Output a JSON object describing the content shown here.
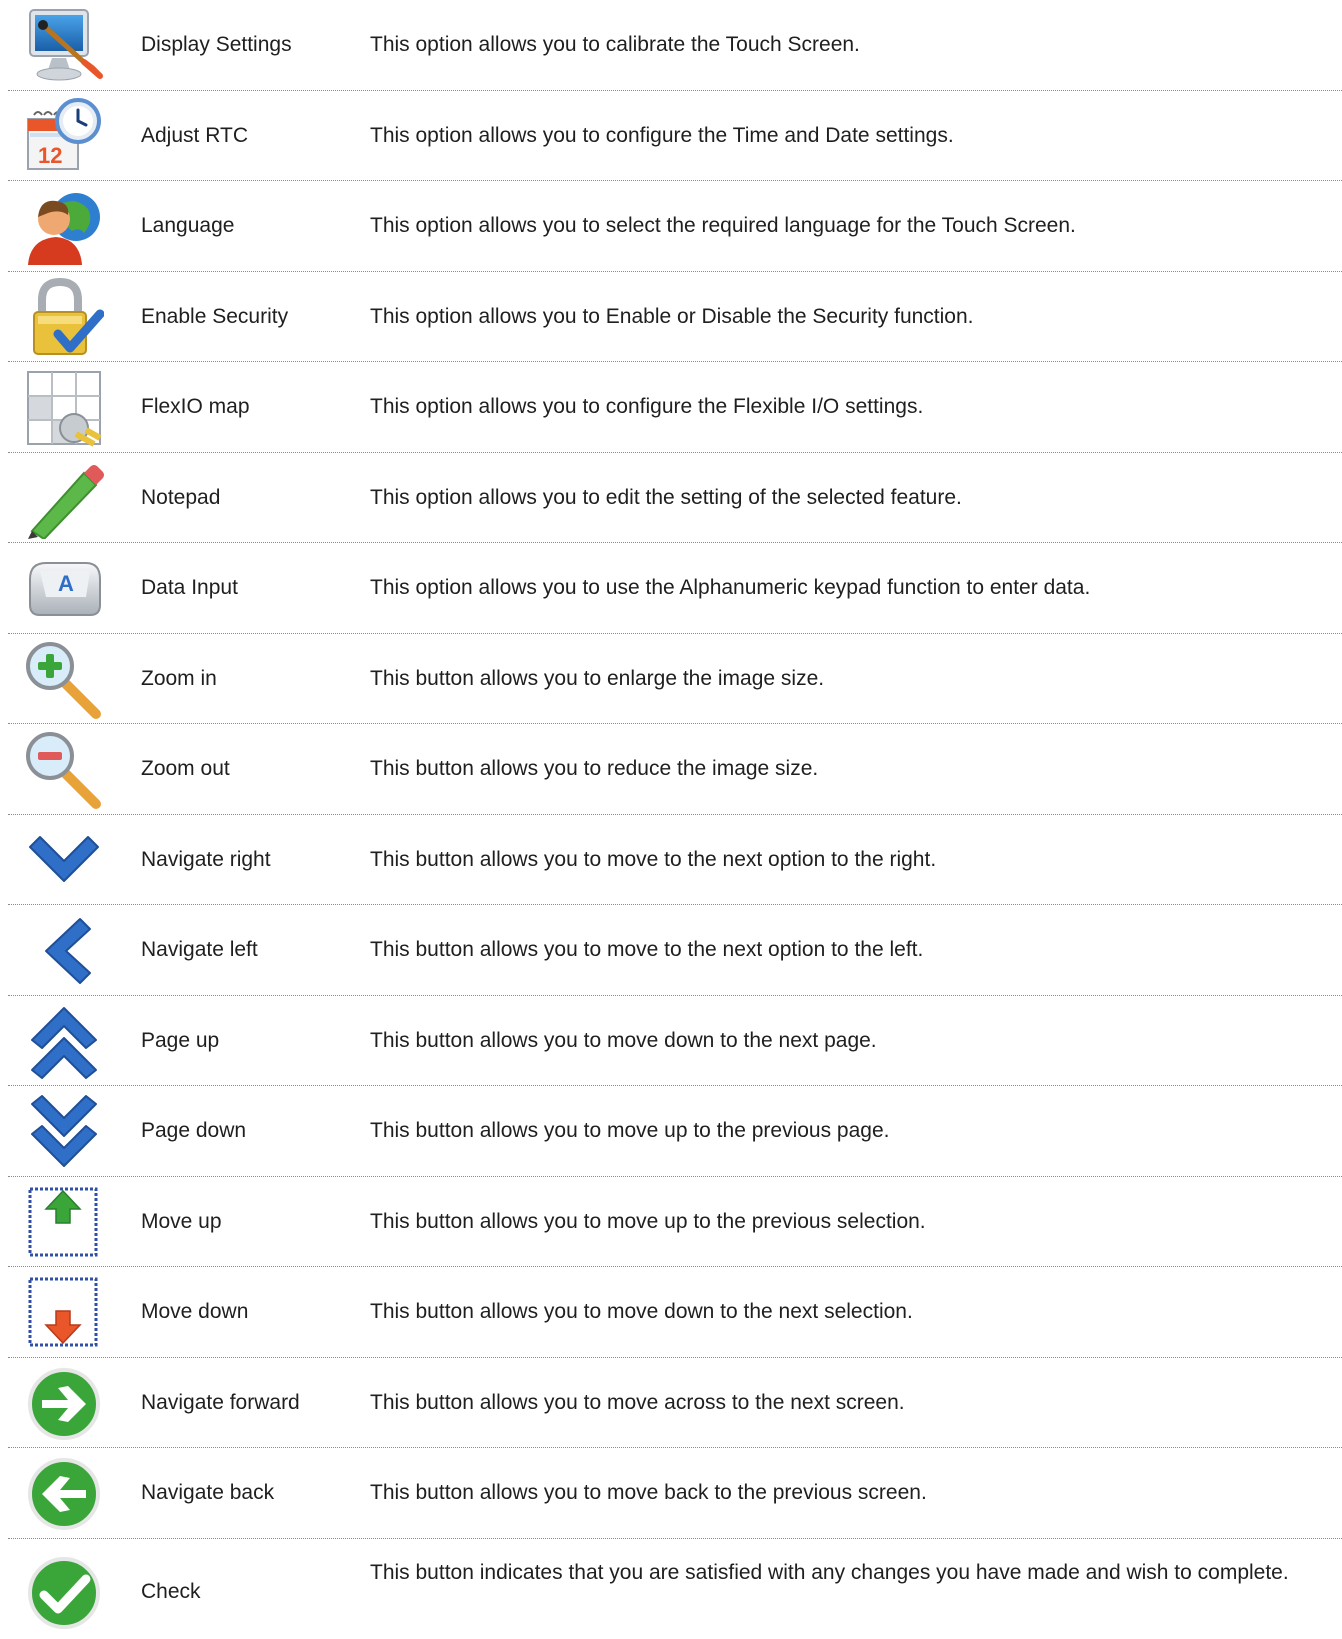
{
  "items": [
    {
      "name": "Display Settings",
      "description": "This option allows you to calibrate the Touch Screen.",
      "icon": "monitor-brush-icon"
    },
    {
      "name": "Adjust RTC",
      "description": "This option allows you to configure the Time and Date settings.",
      "icon": "calendar-clock-icon"
    },
    {
      "name": "Language",
      "description": "This option allows you to select the required language for the Touch Screen.",
      "icon": "user-globe-icon"
    },
    {
      "name": "Enable Security",
      "description": "This option allows you to Enable or Disable the Security function.",
      "icon": "padlock-check-icon"
    },
    {
      "name": "FlexIO map",
      "description": "This option allows you to configure the Flexible I/O settings.",
      "icon": "grid-plug-icon"
    },
    {
      "name": "Notepad",
      "description": "This option allows you to edit the setting of the selected feature.",
      "icon": "pencil-icon"
    },
    {
      "name": "Data Input",
      "description": "This option allows you to use the Alphanumeric keypad function to enter data.",
      "icon": "keyboard-key-icon"
    },
    {
      "name": "Zoom in",
      "description": "This button allows you to enlarge the image size.",
      "icon": "zoom-in-icon"
    },
    {
      "name": "Zoom out",
      "description": "This button allows you to reduce the image size.",
      "icon": "zoom-out-icon"
    },
    {
      "name": "Navigate right",
      "description": "This button allows you to move to the next option to the right.",
      "icon": "chevron-down-icon"
    },
    {
      "name": "Navigate left",
      "description": "This button allows you to move to the next option to the left.",
      "icon": "chevron-left-icon"
    },
    {
      "name": "Page up",
      "description": "This button allows you to move down to the next page.",
      "icon": "double-chevron-up-icon"
    },
    {
      "name": "Page down",
      "description": "This button allows you to move up to the previous page.",
      "icon": "double-chevron-down-icon"
    },
    {
      "name": "Move up",
      "description": "This button allows you to move up to the previous selection.",
      "icon": "move-up-arrow-icon"
    },
    {
      "name": "Move down",
      "description": "This button allows you to move down to the next selection.",
      "icon": "move-down-arrow-icon"
    },
    {
      "name": "Navigate forward",
      "description": "This button allows you to move across to the next screen.",
      "icon": "arrow-right-circle-icon"
    },
    {
      "name": "Navigate back",
      "description": "This button allows you to move back to the previous screen.",
      "icon": "arrow-left-circle-icon"
    },
    {
      "name": "Check",
      "description": "This button indicates that you are satisfied with any changes you have made and wish to complete.",
      "icon": "check-circle-icon"
    }
  ],
  "colors": {
    "blue": "#2f6fc7",
    "green": "#3aa63a",
    "orange": "#e8562a",
    "gold": "#e9c13b"
  }
}
